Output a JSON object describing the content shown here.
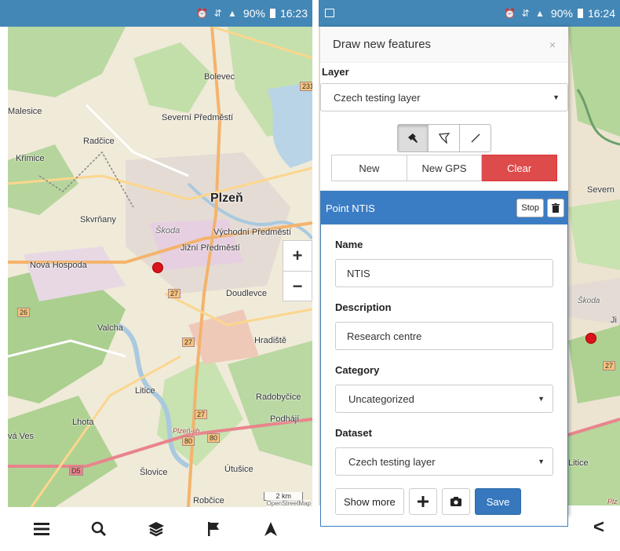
{
  "left_phone": {
    "status": {
      "icons": "⏰ ⇵ ▲",
      "battery": "90%",
      "time": "16:23"
    },
    "map": {
      "labels": {
        "bolevec": "Bolevec",
        "malesice": "Malesice",
        "severni": "Severní Předměstí",
        "radcice": "Radčice",
        "krimice": "Křimice",
        "plzen": "Plzeň",
        "skvrnany": "Skvrňany",
        "skoda": "Škoda",
        "vychodni": "Východní Předměstí",
        "jizni": "Jižní Předměstí",
        "nova_hospoda": "Nová Hospoda",
        "doudlevce": "Doudlevce",
        "valcha": "Valcha",
        "hradiste": "Hradiště",
        "litice": "Litice",
        "radobycice": "Radobyčice",
        "lhota": "Lhota",
        "podhaji": "Podhájí",
        "va_ves": "vá Ves",
        "plzen_jih": "Plzeň-jih",
        "slovice": "Šlovice",
        "utusice": "Útušice",
        "robcice": "Robčice"
      },
      "shields": {
        "r231": "231",
        "r27a": "27",
        "r27b": "27",
        "r27c": "27",
        "r26": "26",
        "r80a": "80",
        "r80b": "80",
        "d5": "D5"
      },
      "zoom_in": "+",
      "zoom_out": "−",
      "scale": "2 km",
      "attribution": "OpenStreetMap"
    },
    "nav": {
      "menu": "menu-icon",
      "search": "search-icon",
      "layers": "layers-icon",
      "flag": "flag-icon",
      "navigate": "navigation-arrow-icon"
    }
  },
  "right_phone": {
    "status": {
      "icons": "⏰ ⇵ ▲",
      "battery": "90%",
      "time": "16:24"
    },
    "panel": {
      "title": "Draw new features",
      "close": "×",
      "layer_label": "Layer",
      "layer_value": "Czech testing layer",
      "actions": {
        "new": "New",
        "new_gps": "New GPS",
        "clear": "Clear"
      },
      "feature": {
        "title": "Point NTIS",
        "stop": "Stop",
        "name_label": "Name",
        "name_value": "NTIS",
        "description_label": "Description",
        "description_value": "Research centre",
        "category_label": "Category",
        "category_value": "Uncategorized",
        "dataset_label": "Dataset",
        "dataset_value": "Czech testing layer",
        "show_more": "Show more",
        "save": "Save"
      }
    },
    "map_labels": {
      "severn": "Severn",
      "skoda": "Škoda",
      "ji": "Ji",
      "r27": "27",
      "litice": "Litice",
      "plz": "Plz"
    },
    "back": "<"
  },
  "colors": {
    "statusbar": "#4387b6",
    "feature_header": "#3b7dc4",
    "clear": "#dd4b4b",
    "save": "#3677bd",
    "marker": "#d9141c"
  }
}
